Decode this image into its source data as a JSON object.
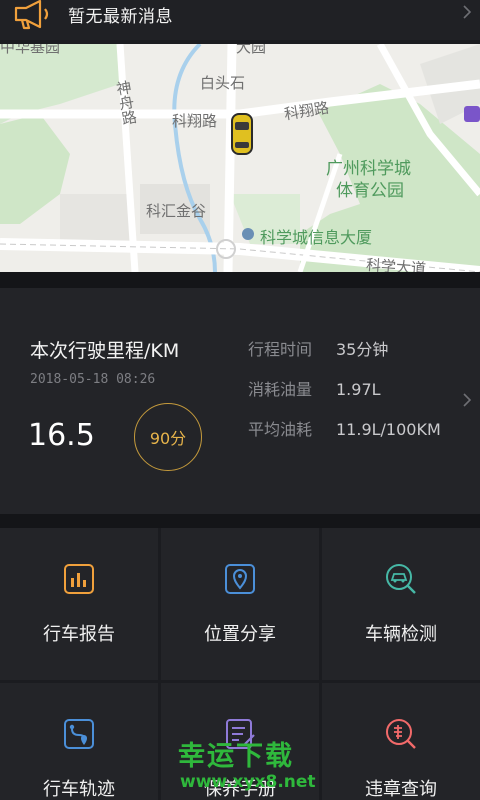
{
  "notice": {
    "text": "暂无最新消息"
  },
  "map": {
    "labels": {
      "baitoushi": "白头石",
      "shenzhou": "神舟路",
      "kexiang_left": "科翔路",
      "kexiang_right": "科翔路",
      "park_line1": "广州科学城",
      "park_line2": "体育公园",
      "kehui": "科汇金谷",
      "building": "科学城信息大厦",
      "kexue": "科学大道",
      "top_left": "中华基园",
      "top_mid": "大园"
    }
  },
  "trip": {
    "title": "本次行驶里程/KM",
    "date": "2018-05-18 08:26",
    "distance": "16.5",
    "score": "90分",
    "stats": [
      {
        "label": "行程时间",
        "value": "35分钟"
      },
      {
        "label": "消耗油量",
        "value": "1.97L"
      },
      {
        "label": "平均油耗",
        "value": "11.9L/100KM"
      }
    ]
  },
  "grid": {
    "items": [
      {
        "label": "行车报告",
        "icon": "bar-chart-icon"
      },
      {
        "label": "位置分享",
        "icon": "location-pin-icon"
      },
      {
        "label": "车辆检测",
        "icon": "car-scan-icon"
      },
      {
        "label": "行车轨迹",
        "icon": "route-icon"
      },
      {
        "label": "保养手册",
        "icon": "manual-icon"
      },
      {
        "label": "违章查询",
        "icon": "violation-icon"
      }
    ]
  },
  "watermark": {
    "line1": "幸运下载",
    "line2": "www.xyx8.net"
  },
  "colors": {
    "accent": "#e7b44b",
    "icon_orange": "#f0a03c",
    "icon_blue": "#4b8fd8",
    "icon_teal": "#46b8a6",
    "icon_pink": "#f26a6a",
    "watermark": "#2fb83c"
  }
}
